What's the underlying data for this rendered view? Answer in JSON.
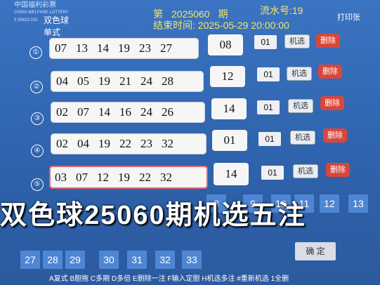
{
  "header": {
    "logo_cn": "中国福利彩票",
    "logo_en": "CHINA WELFARE LOTTERY",
    "logo_code": "3 35623 015",
    "game_type": "双色球",
    "play_type": "单式",
    "issue_label": "第",
    "issue_number": "2025060",
    "issue_suffix": "期",
    "end_label": "结束时间:",
    "end_date": "2025-05-29",
    "end_time": "20:00:00",
    "serial_label": "流水号:",
    "serial_number": "19",
    "print_label": "打印张"
  },
  "tickets": [
    {
      "index": "①",
      "reds": [
        "07",
        "13",
        "14",
        "19",
        "23",
        "27"
      ],
      "blue": "08",
      "multiple": "01",
      "random_label": "机选",
      "delete_label": "删除"
    },
    {
      "index": "②",
      "reds": [
        "04",
        "05",
        "19",
        "21",
        "24",
        "28"
      ],
      "blue": "12",
      "multiple": "01",
      "random_label": "机选",
      "delete_label": "删除"
    },
    {
      "index": "③",
      "reds": [
        "02",
        "07",
        "14",
        "16",
        "24",
        "26"
      ],
      "blue": "14",
      "multiple": "01",
      "random_label": "机选",
      "delete_label": "删除"
    },
    {
      "index": "④",
      "reds": [
        "02",
        "04",
        "19",
        "22",
        "23",
        "32"
      ],
      "blue": "01",
      "multiple": "01",
      "random_label": "机选",
      "delete_label": "删除"
    },
    {
      "index": "⑤",
      "reds": [
        "03",
        "07",
        "12",
        "19",
        "22",
        "32"
      ],
      "blue": "14",
      "multiple": "01",
      "random_label": "机选",
      "delete_label": "删除"
    }
  ],
  "keypad": {
    "row1": [
      "8",
      "9",
      "10",
      "11",
      "12",
      "13"
    ],
    "row2": [
      "27",
      "28",
      "29",
      "30",
      "31",
      "32",
      "33"
    ],
    "confirm_label": "确  定"
  },
  "hint_text": "A复式 B胆拖 C多期 D多倍 E删除一注 F输入定胆 H机选多注 #重新机选 1全删",
  "overlay_text": "双色球25060期机选五注",
  "colors": {
    "background": "#3b74c2",
    "delete": "#d9463b",
    "issue_text": "#f2e46a"
  }
}
